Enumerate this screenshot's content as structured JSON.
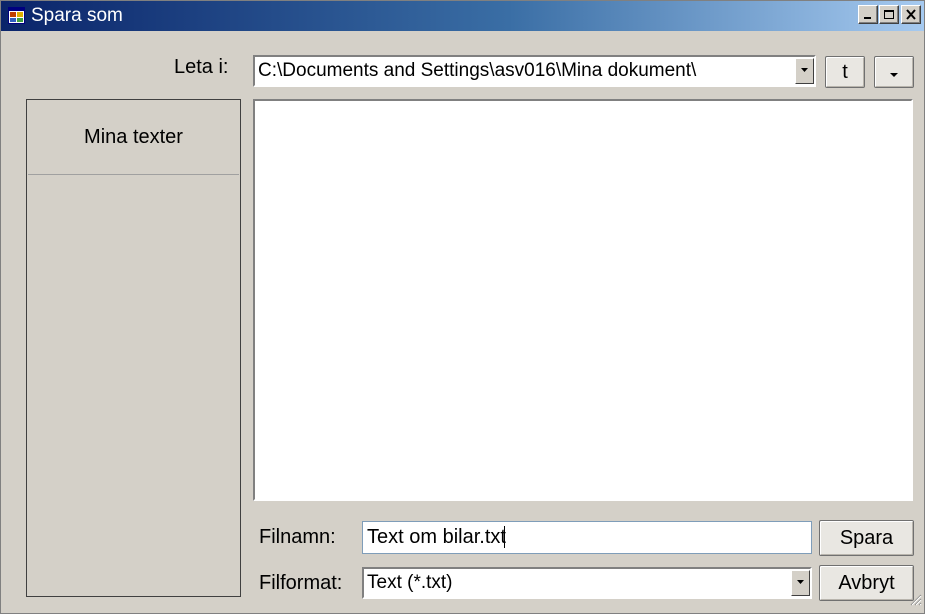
{
  "window": {
    "title": "Spara som",
    "icon": "app-window-icon",
    "controls": [
      "minimize-icon",
      "maximize-icon",
      "close-icon"
    ]
  },
  "location": {
    "label": "Leta i:",
    "value": "C:\\Documents and Settings\\asv016\\Mina dokument\\",
    "up_button_label": "t"
  },
  "sidebar": {
    "items": [
      {
        "label": "Mina texter"
      }
    ]
  },
  "filename": {
    "label": "Filnamn:",
    "value": "Text om bilar.txt"
  },
  "fileformat": {
    "label": "Filformat:",
    "selected": "Text (*.txt)"
  },
  "buttons": {
    "save": "Spara",
    "cancel": "Avbryt"
  },
  "colors": {
    "title_gradient_start": "#0a246a",
    "title_gradient_end": "#a6caf0",
    "window_face": "#d4d0c8"
  }
}
